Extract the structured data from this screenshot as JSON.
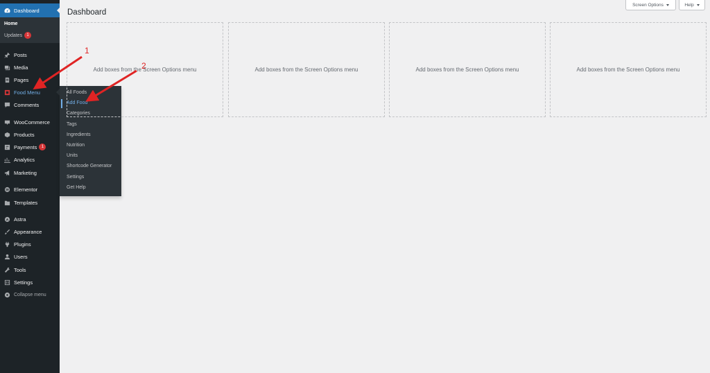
{
  "sidebar": {
    "dashboard": "Dashboard",
    "home": "Home",
    "updates": "Updates",
    "updates_count": "1",
    "items": [
      {
        "label": "Posts",
        "icon": "pin-icon"
      },
      {
        "label": "Media",
        "icon": "media-icon"
      },
      {
        "label": "Pages",
        "icon": "pages-icon"
      },
      {
        "label": "Food Menu",
        "icon": "food-menu-icon"
      },
      {
        "label": "Comments",
        "icon": "comments-icon"
      },
      {
        "label": "WooCommerce",
        "icon": "woocommerce-icon"
      },
      {
        "label": "Products",
        "icon": "products-icon"
      },
      {
        "label": "Payments",
        "icon": "payments-icon",
        "badge": "1"
      },
      {
        "label": "Analytics",
        "icon": "analytics-icon"
      },
      {
        "label": "Marketing",
        "icon": "megaphone-icon"
      },
      {
        "label": "Elementor",
        "icon": "elementor-icon"
      },
      {
        "label": "Templates",
        "icon": "folder-icon"
      },
      {
        "label": "Astra",
        "icon": "astra-icon"
      },
      {
        "label": "Appearance",
        "icon": "brush-icon"
      },
      {
        "label": "Plugins",
        "icon": "plug-icon"
      },
      {
        "label": "Users",
        "icon": "users-icon"
      },
      {
        "label": "Tools",
        "icon": "wrench-icon"
      },
      {
        "label": "Settings",
        "icon": "settings-icon"
      },
      {
        "label": "Collapse menu",
        "icon": "collapse-icon"
      }
    ]
  },
  "flyout": {
    "items": [
      "All Foods",
      "Add Food",
      "Categories",
      "Tags",
      "Ingredients",
      "Nutrition",
      "Units",
      "Shortcode Generator",
      "Settings",
      "Get Help"
    ]
  },
  "header": {
    "title": "Dashboard",
    "screen_options": "Screen Options",
    "help": "Help"
  },
  "boxes": {
    "text": "Add boxes from the Screen Options menu"
  },
  "annotations": {
    "step1": "1",
    "step2": "2",
    "color": "#e02424"
  },
  "colors": {
    "sidebar_bg": "#1d2327",
    "accent": "#2271b1",
    "submenu_bg": "#2c3338",
    "highlight_text": "#72aee6",
    "badge": "#d63638"
  }
}
